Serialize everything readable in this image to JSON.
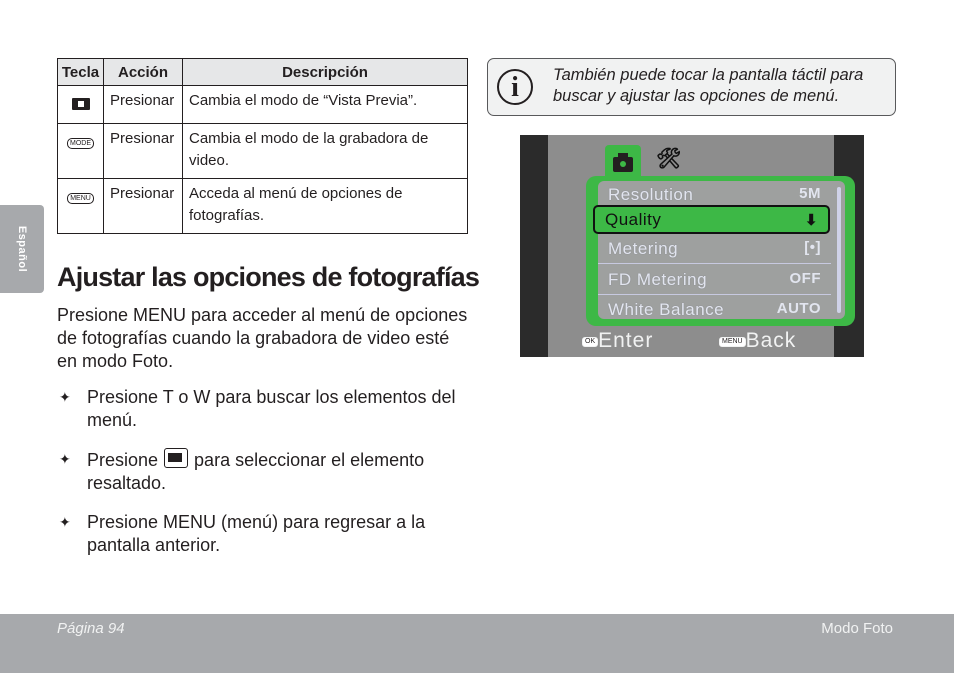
{
  "side_tab": "Español",
  "table": {
    "headers": [
      "Tecla",
      "Acción",
      "Descripción"
    ],
    "rows": [
      {
        "key_icon": "camera-button-icon",
        "key_label": "",
        "action": "Presionar",
        "description": "Cambia el modo de “Vista Previa”."
      },
      {
        "key_icon": "mode-button-icon",
        "key_label": "MODE",
        "action": "Presionar",
        "description": "Cambia el modo de la grabadora de video."
      },
      {
        "key_icon": "menu-button-icon",
        "key_label": "MENU",
        "action": "Presionar",
        "description": "Acceda al menú de opciones de fotografías."
      }
    ]
  },
  "section": {
    "title": "Ajustar las opciones de fotografías",
    "intro": "Presione MENU para acceder al menú de opciones de fotografías cuando la grabadora de video esté en modo Foto.",
    "bullets": [
      {
        "text": "Presione T o W para buscar los elementos del menú."
      },
      {
        "before": "Presione",
        "after": "para seleccionar el elemento resaltado.",
        "icon": "camera-button-icon"
      },
      {
        "text": "Presione MENU (menú) para regresar a la pantalla anterior."
      }
    ]
  },
  "note": {
    "icon": "info-icon",
    "glyph": "i",
    "text": "También puede tocar la pantalla táctil para buscar y ajustar las opciones de menú."
  },
  "camera_screen": {
    "tabs": [
      {
        "icon": "camera-icon"
      },
      {
        "icon": "tools-icon",
        "glyph": "🛠"
      }
    ],
    "menu_items": [
      {
        "label": "Resolution",
        "value": "5M"
      },
      {
        "label": "Quality",
        "value": "⬇"
      },
      {
        "label": "Metering",
        "value": "[•]"
      },
      {
        "label": "FD Metering",
        "value": "OFF"
      },
      {
        "label": "White Balance",
        "value": "AUTO"
      }
    ],
    "selected_index": 1,
    "footer": {
      "ok_chip": "OK",
      "ok_label": "Enter",
      "menu_chip": "MENU",
      "menu_label": "Back"
    }
  },
  "footer": {
    "page": "Página 94",
    "section": "Modo Foto"
  },
  "colors": {
    "accent_green": "#3db846",
    "footer_grey": "#a7a9ac"
  }
}
